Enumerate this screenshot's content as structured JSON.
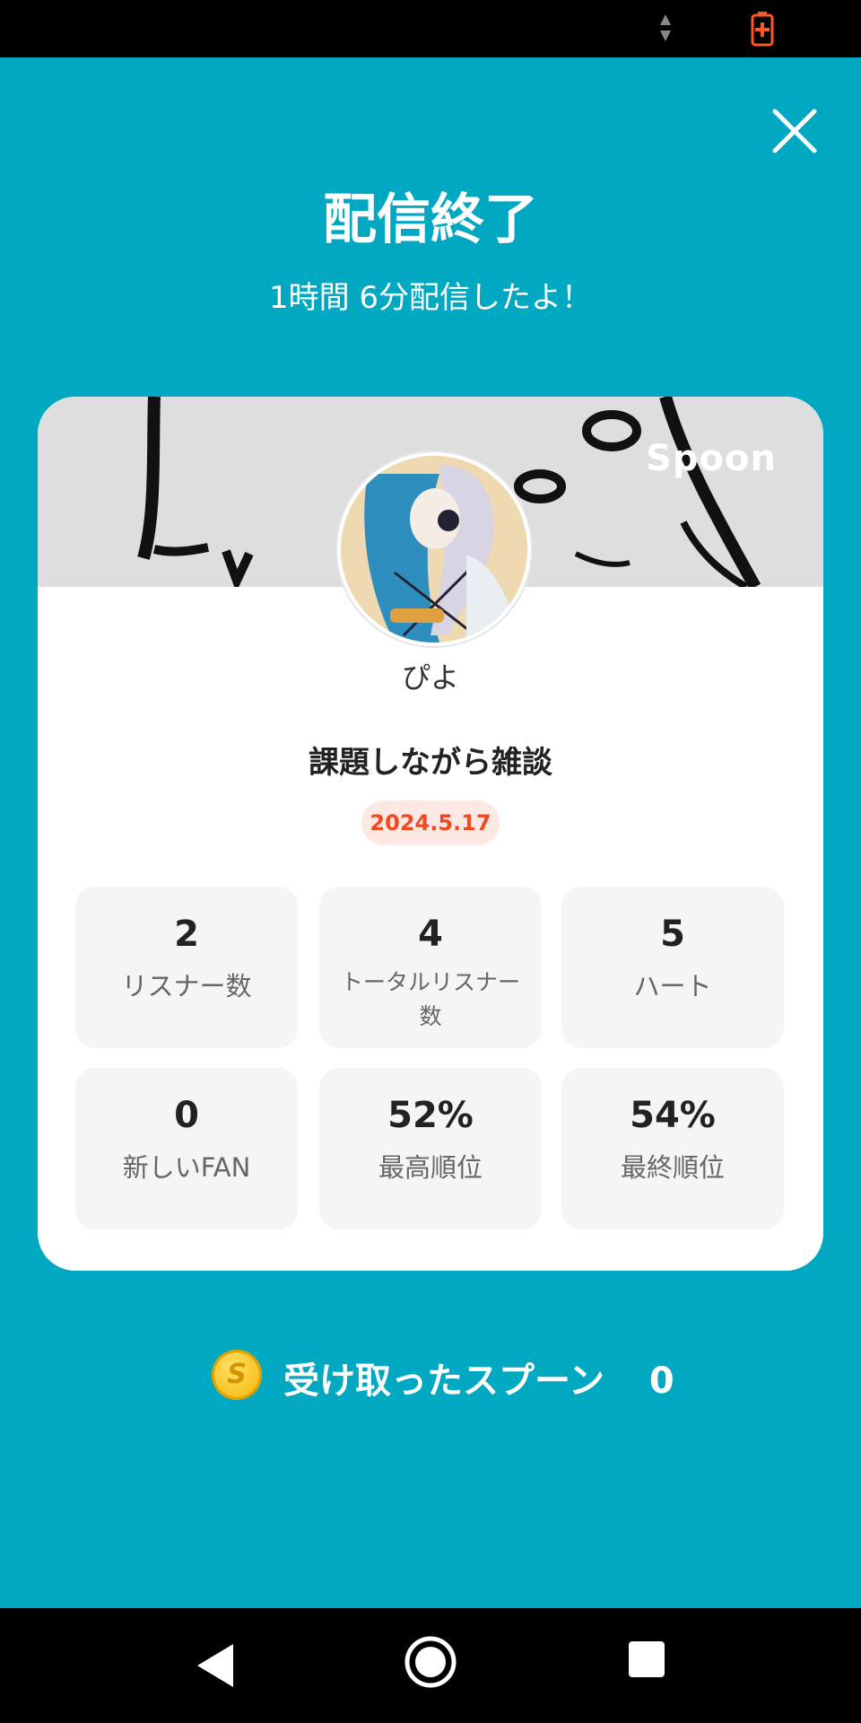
{
  "header": {
    "title": "配信終了",
    "subtitle": "1時間 6分配信したよ！"
  },
  "card": {
    "brand": "Spoon",
    "username": "ぴよ",
    "live_title": "課題しながら雑談",
    "date": "2024.5.17",
    "stats": [
      {
        "value": "2",
        "label": "リスナー数"
      },
      {
        "value": "4",
        "label": "トータルリスナー数"
      },
      {
        "value": "5",
        "label": "ハート"
      },
      {
        "value": "0",
        "label": "新しいFAN"
      },
      {
        "value": "52%",
        "label": "最高順位"
      },
      {
        "value": "54%",
        "label": "最終順位"
      }
    ]
  },
  "spoons": {
    "coin_letter": "S",
    "label": "受け取ったスプーン",
    "count": "0"
  },
  "colors": {
    "background": "#00a8c1",
    "date_text": "#f04a23",
    "date_bg": "#fde8e4",
    "battery": "#ff5722"
  }
}
